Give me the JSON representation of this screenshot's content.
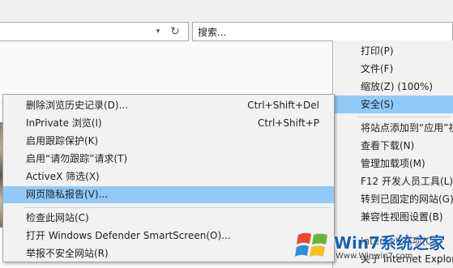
{
  "toolbar": {
    "search_placeholder": "搜索...",
    "dropdown_glyph": "▾",
    "refresh_glyph": "↻"
  },
  "tools_menu": {
    "items": [
      {
        "label": "打印(P)"
      },
      {
        "label": "文件(F)"
      },
      {
        "label": "缩放(Z) (100%)"
      },
      {
        "label": "安全(S)",
        "highlighted": true
      },
      {
        "label": "将站点添加到“应用”视图(I)"
      },
      {
        "label": "查看下载(N)"
      },
      {
        "label": "管理加载项(M)"
      },
      {
        "label": "F12 开发人员工具(L)"
      },
      {
        "label": "转到已固定的网站(G)"
      },
      {
        "label": "兼容性视图设置(B)"
      },
      {
        "label": "Internet 选项(O)"
      },
      {
        "label": "关于 Internet Explorer(A)"
      }
    ]
  },
  "security_menu": {
    "items": [
      {
        "label": "删除浏览历史记录(D)...",
        "shortcut": "Ctrl+Shift+Del"
      },
      {
        "label": "InPrivate 浏览(I)",
        "shortcut": "Ctrl+Shift+P"
      },
      {
        "label": "启用跟踪保护(K)",
        "shortcut": ""
      },
      {
        "label": "启用“请勿跟踪”请求(T)",
        "shortcut": ""
      },
      {
        "label": "ActiveX 筛选(X)",
        "shortcut": ""
      },
      {
        "label": "网页隐私报告(V)...",
        "shortcut": "",
        "highlighted": true
      },
      {
        "label": "检查此网站(C)",
        "shortcut": ""
      },
      {
        "label": "打开 Windows Defender SmartScreen(O)...",
        "shortcut": ""
      },
      {
        "label": "举报不安全网站(R)",
        "shortcut": ""
      }
    ]
  },
  "watermark": {
    "text": "Win7系统之家",
    "url": "Www.Winwin7.com"
  },
  "colors": {
    "highlight": "#91c9f7",
    "menu_bg": "#f2f2f2"
  }
}
